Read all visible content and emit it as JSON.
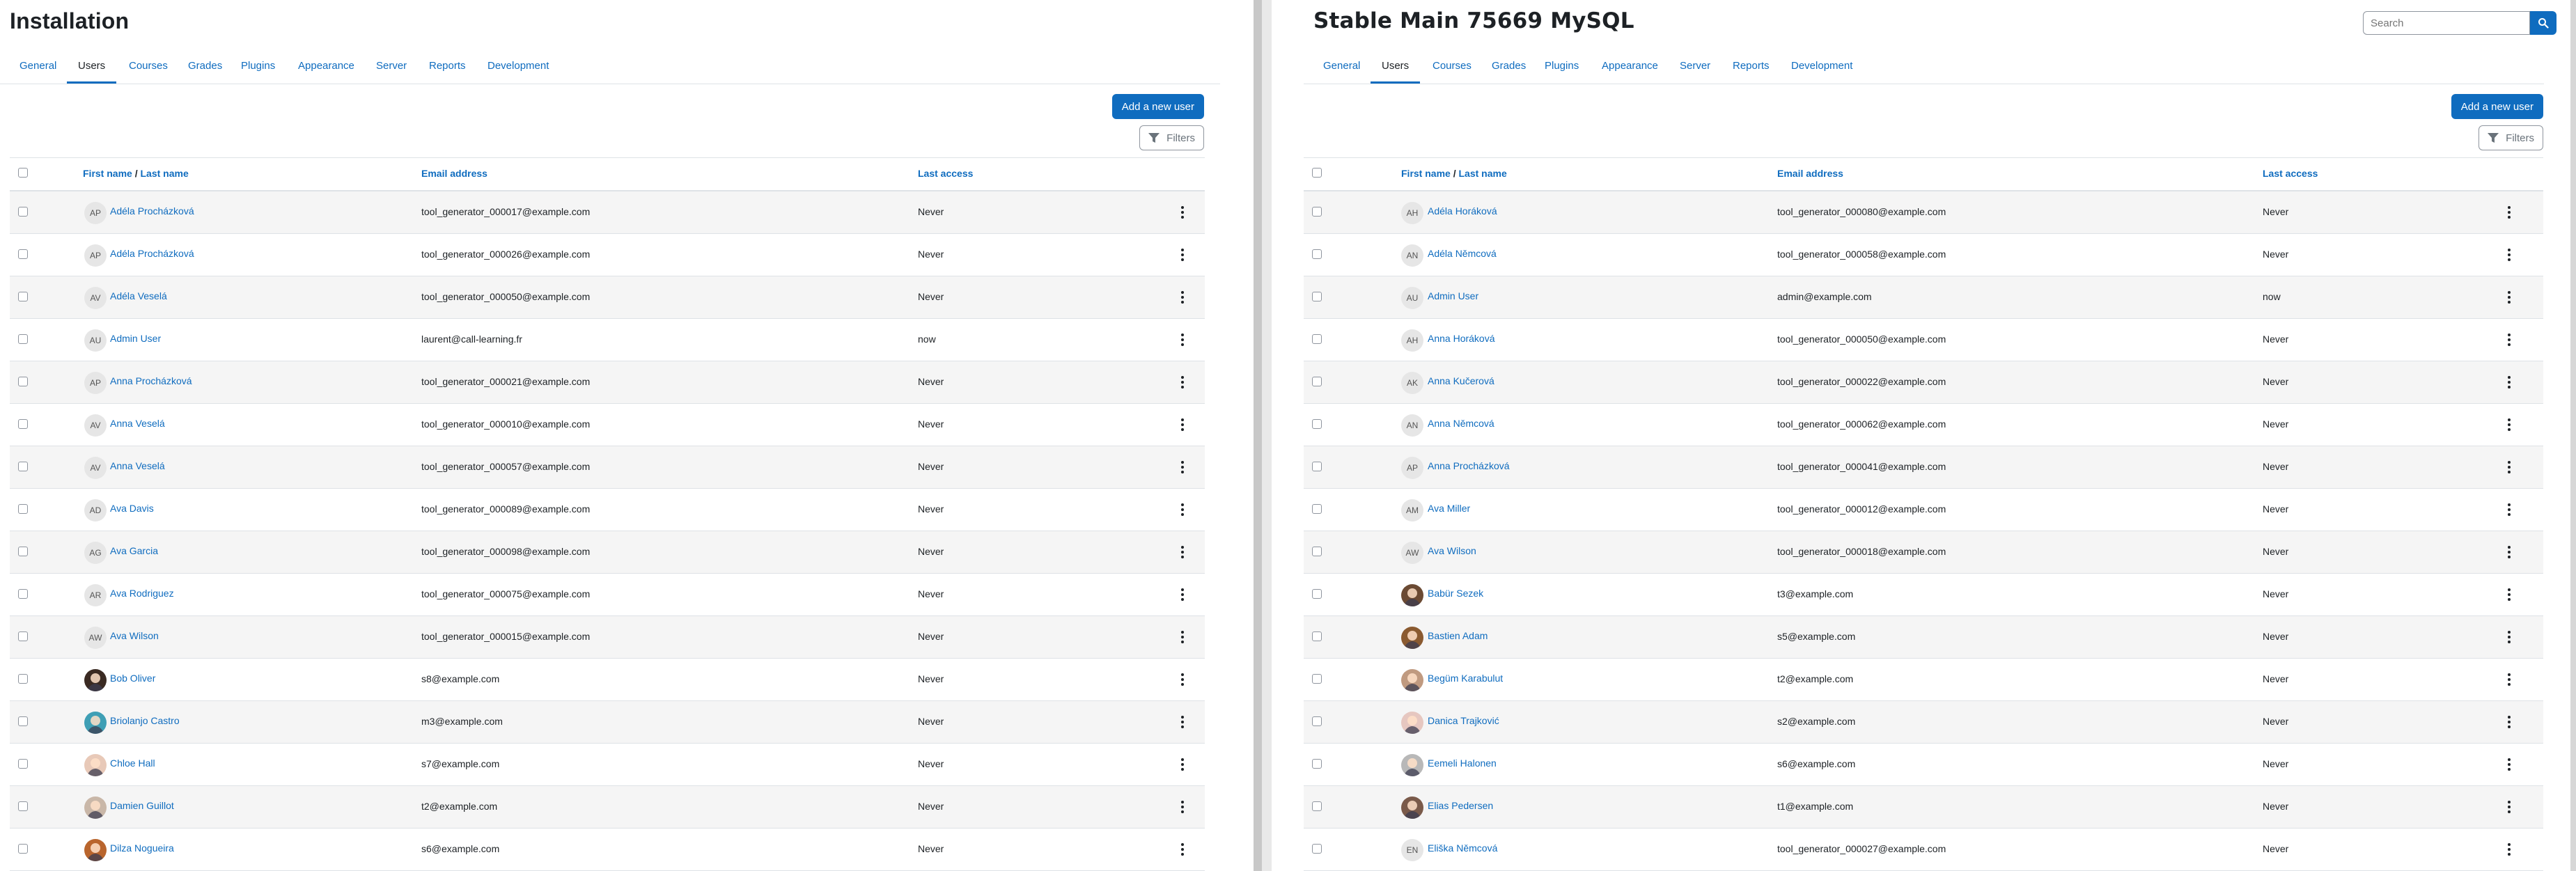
{
  "left": {
    "title": "Installation",
    "tabs": [
      "General",
      "Users",
      "Courses",
      "Grades",
      "Plugins",
      "Appearance",
      "Server",
      "Reports",
      "Development"
    ],
    "active_tab": "Users",
    "add_user_label": "Add a new user",
    "filters_label": "Filters",
    "columns": {
      "first_name": "First name",
      "slash": "/",
      "last_name": "Last name",
      "email": "Email address",
      "last_access": "Last access"
    },
    "rows": [
      {
        "initials": "AP",
        "name": "Adéla Procházková",
        "email": "tool_generator_000017@example.com",
        "access": "Never",
        "photo": false
      },
      {
        "initials": "AP",
        "name": "Adéla Procházková",
        "email": "tool_generator_000026@example.com",
        "access": "Never",
        "photo": false
      },
      {
        "initials": "AV",
        "name": "Adéla Veselá",
        "email": "tool_generator_000050@example.com",
        "access": "Never",
        "photo": false
      },
      {
        "initials": "AU",
        "name": "Admin User",
        "email": "laurent@call-learning.fr",
        "access": "now",
        "photo": false
      },
      {
        "initials": "AP",
        "name": "Anna Procházková",
        "email": "tool_generator_000021@example.com",
        "access": "Never",
        "photo": false
      },
      {
        "initials": "AV",
        "name": "Anna Veselá",
        "email": "tool_generator_000010@example.com",
        "access": "Never",
        "photo": false
      },
      {
        "initials": "AV",
        "name": "Anna Veselá",
        "email": "tool_generator_000057@example.com",
        "access": "Never",
        "photo": false
      },
      {
        "initials": "AD",
        "name": "Ava Davis",
        "email": "tool_generator_000089@example.com",
        "access": "Never",
        "photo": false
      },
      {
        "initials": "AG",
        "name": "Ava Garcia",
        "email": "tool_generator_000098@example.com",
        "access": "Never",
        "photo": false
      },
      {
        "initials": "AR",
        "name": "Ava Rodriguez",
        "email": "tool_generator_000075@example.com",
        "access": "Never",
        "photo": false
      },
      {
        "initials": "AW",
        "name": "Ava Wilson",
        "email": "tool_generator_000015@example.com",
        "access": "Never",
        "photo": false
      },
      {
        "initials": "",
        "name": "Bob Oliver",
        "email": "s8@example.com",
        "access": "Never",
        "photo": true,
        "tone": "#3a2a22"
      },
      {
        "initials": "",
        "name": "Briolanjo Castro",
        "email": "m3@example.com",
        "access": "Never",
        "photo": true,
        "tone": "#3f9fb5"
      },
      {
        "initials": "",
        "name": "Chloe Hall",
        "email": "s7@example.com",
        "access": "Never",
        "photo": true,
        "tone": "#e8c9b8"
      },
      {
        "initials": "",
        "name": "Damien Guillot",
        "email": "t2@example.com",
        "access": "Never",
        "photo": true,
        "tone": "#c9b7a8"
      },
      {
        "initials": "",
        "name": "Dilza Nogueira",
        "email": "s6@example.com",
        "access": "Never",
        "photo": true,
        "tone": "#b9652d"
      }
    ]
  },
  "right": {
    "title": "Stable Main 75669 MySQL",
    "search_placeholder": "Search",
    "tabs": [
      "General",
      "Users",
      "Courses",
      "Grades",
      "Plugins",
      "Appearance",
      "Server",
      "Reports",
      "Development"
    ],
    "active_tab": "Users",
    "add_user_label": "Add a new user",
    "filters_label": "Filters",
    "columns": {
      "first_name": "First name",
      "slash": "/",
      "last_name": "Last name",
      "email": "Email address",
      "last_access": "Last access"
    },
    "rows": [
      {
        "initials": "AH",
        "name": "Adéla Horáková",
        "email": "tool_generator_000080@example.com",
        "access": "Never",
        "photo": false
      },
      {
        "initials": "AN",
        "name": "Adéla Němcová",
        "email": "tool_generator_000058@example.com",
        "access": "Never",
        "photo": false
      },
      {
        "initials": "AU",
        "name": "Admin User",
        "email": "admin@example.com",
        "access": "now",
        "photo": false
      },
      {
        "initials": "AH",
        "name": "Anna Horáková",
        "email": "tool_generator_000050@example.com",
        "access": "Never",
        "photo": false
      },
      {
        "initials": "AK",
        "name": "Anna Kučerová",
        "email": "tool_generator_000022@example.com",
        "access": "Never",
        "photo": false
      },
      {
        "initials": "AN",
        "name": "Anna Němcová",
        "email": "tool_generator_000062@example.com",
        "access": "Never",
        "photo": false
      },
      {
        "initials": "AP",
        "name": "Anna Procházková",
        "email": "tool_generator_000041@example.com",
        "access": "Never",
        "photo": false
      },
      {
        "initials": "AM",
        "name": "Ava Miller",
        "email": "tool_generator_000012@example.com",
        "access": "Never",
        "photo": false
      },
      {
        "initials": "AW",
        "name": "Ava Wilson",
        "email": "tool_generator_000018@example.com",
        "access": "Never",
        "photo": false
      },
      {
        "initials": "",
        "name": "Babür Sezek",
        "email": "t3@example.com",
        "access": "Never",
        "photo": true,
        "tone": "#6b4a33"
      },
      {
        "initials": "",
        "name": "Bastien Adam",
        "email": "s5@example.com",
        "access": "Never",
        "photo": true,
        "tone": "#8a5a30"
      },
      {
        "initials": "",
        "name": "Begüm Karabulut",
        "email": "t2@example.com",
        "access": "Never",
        "photo": true,
        "tone": "#c09a80"
      },
      {
        "initials": "",
        "name": "Danica Trajković",
        "email": "s2@example.com",
        "access": "Never",
        "photo": true,
        "tone": "#e6c7c0"
      },
      {
        "initials": "",
        "name": "Eemeli Halonen",
        "email": "s6@example.com",
        "access": "Never",
        "photo": true,
        "tone": "#b8b8b8"
      },
      {
        "initials": "",
        "name": "Elias Pedersen",
        "email": "t1@example.com",
        "access": "Never",
        "photo": true,
        "tone": "#7a5a4a"
      },
      {
        "initials": "EN",
        "name": "Eliška Němcová",
        "email": "tool_generator_000027@example.com",
        "access": "Never",
        "photo": false
      }
    ]
  },
  "colors": {
    "link": "#0f6cbf",
    "primary": "#0f6cbf",
    "stripe": "#f5f5f5",
    "border": "#dee2e6"
  },
  "icons": {
    "search": "search-icon",
    "filter": "filter-icon",
    "actions": "kebab-menu-icon"
  }
}
